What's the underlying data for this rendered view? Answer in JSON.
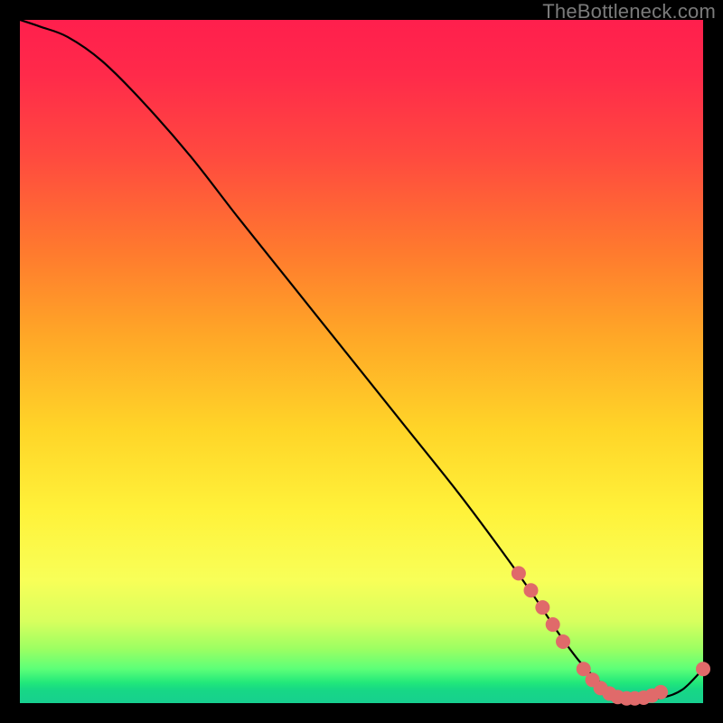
{
  "watermark": "TheBottleneck.com",
  "chart_data": {
    "type": "line",
    "title": "",
    "xlabel": "",
    "ylabel": "",
    "xlim": [
      0,
      100
    ],
    "ylim": [
      0,
      100
    ],
    "series": [
      {
        "name": "bottleneck-curve",
        "x": [
          0,
          3,
          7,
          12,
          18,
          25,
          32,
          40,
          48,
          56,
          64,
          70,
          75,
          79,
          82,
          85,
          88,
          91,
          94,
          97,
          100
        ],
        "y": [
          100,
          99,
          97.5,
          94,
          88,
          80,
          71,
          61,
          51,
          41,
          31,
          23,
          16,
          10,
          6,
          3,
          1.2,
          0.6,
          0.8,
          2,
          5
        ],
        "color": "#000000"
      }
    ],
    "markers": [
      {
        "name": "cluster-upper",
        "color": "#e06a6a",
        "r": 8,
        "points": [
          {
            "x": 73.0,
            "y": 19.0
          },
          {
            "x": 74.8,
            "y": 16.5
          },
          {
            "x": 76.5,
            "y": 14.0
          },
          {
            "x": 78.0,
            "y": 11.5
          },
          {
            "x": 79.5,
            "y": 9.0
          }
        ]
      },
      {
        "name": "cluster-valley",
        "color": "#e06a6a",
        "r": 8,
        "points": [
          {
            "x": 82.5,
            "y": 5.0
          },
          {
            "x": 83.8,
            "y": 3.4
          },
          {
            "x": 85.0,
            "y": 2.2
          },
          {
            "x": 86.3,
            "y": 1.4
          },
          {
            "x": 87.5,
            "y": 0.9
          },
          {
            "x": 88.8,
            "y": 0.7
          },
          {
            "x": 90.0,
            "y": 0.7
          },
          {
            "x": 91.3,
            "y": 0.8
          },
          {
            "x": 92.5,
            "y": 1.1
          },
          {
            "x": 93.8,
            "y": 1.6
          }
        ]
      },
      {
        "name": "cluster-tail",
        "color": "#e06a6a",
        "r": 8,
        "points": [
          {
            "x": 100.0,
            "y": 5.0
          }
        ]
      }
    ],
    "gradient_stops": [
      {
        "pos": 0.0,
        "color": "#ff1f4d"
      },
      {
        "pos": 0.35,
        "color": "#ff7a2e"
      },
      {
        "pos": 0.6,
        "color": "#ffd528"
      },
      {
        "pos": 0.82,
        "color": "#f8ff58"
      },
      {
        "pos": 0.95,
        "color": "#5cff78"
      },
      {
        "pos": 1.0,
        "color": "#17cf8f"
      }
    ]
  }
}
